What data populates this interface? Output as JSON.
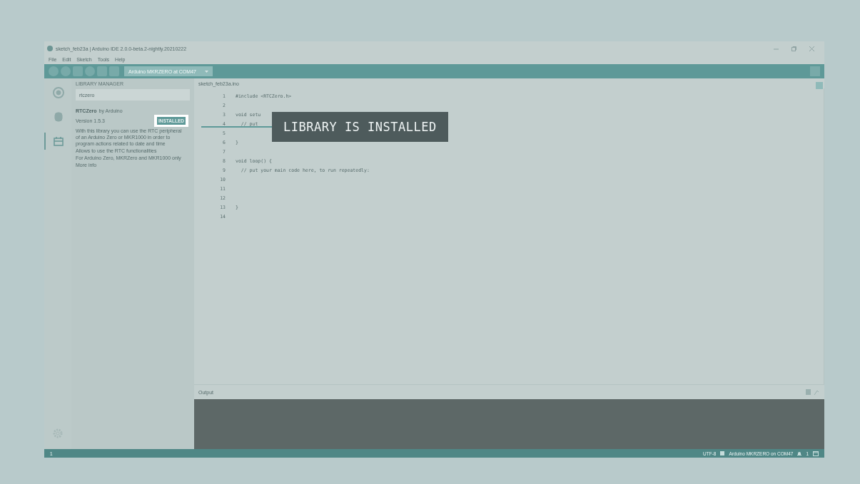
{
  "window": {
    "title": "sketch_feb23a | Arduino IDE 2.0.0-beta.2-nightly.20210222"
  },
  "menu": [
    "File",
    "Edit",
    "Sketch",
    "Tools",
    "Help"
  ],
  "toolbar": {
    "board": "Arduino MKRZERO at COM47"
  },
  "sidebar": {
    "items": [
      {
        "kind": "boards",
        "selected": false
      },
      {
        "kind": "debug",
        "selected": false
      },
      {
        "kind": "library",
        "selected": true
      }
    ]
  },
  "library_manager": {
    "title": "LIBRARY MANAGER",
    "search": {
      "value": "rtczero"
    },
    "libraries": [
      {
        "name": "RTCZero",
        "by": "by Arduino",
        "version": "Version 1.5.3",
        "installed_label": "INSTALLED",
        "description": [
          "With this library you can use the RTC peripheral of an Arduino Zero or MKR1000 in order to program actions related to date and time",
          "Allows to use the RTC functionalities",
          "For Arduino Zero, MKRZero and MKR1000 only"
        ],
        "more": "More info"
      }
    ]
  },
  "editor": {
    "tab": "sketch_feb23a.ino",
    "lines": [
      {
        "number": "1",
        "code": "#include <RTCZero.h>"
      },
      {
        "number": "2"
      },
      {
        "number": "3",
        "code": "void setu"
      },
      {
        "number": "4",
        "code": "  // put"
      },
      {
        "number": "5"
      },
      {
        "number": "6",
        "code": "}"
      },
      {
        "number": "7"
      },
      {
        "number": "8",
        "code": "void loop() {"
      },
      {
        "number": "9",
        "code": "  // put your main code here, to run repeatedly:"
      },
      {
        "number": "10"
      },
      {
        "number": "11"
      },
      {
        "number": "12"
      },
      {
        "number": "13",
        "code": "}"
      },
      {
        "number": "14"
      }
    ]
  },
  "output": {
    "title": "Output"
  },
  "status_bar": {
    "line": "1",
    "encoding": "UTF-8",
    "board": "Arduino MKRZERO on COM47",
    "notifications": "1"
  },
  "callout": {
    "text": "LIBRARY IS INSTALLED"
  }
}
